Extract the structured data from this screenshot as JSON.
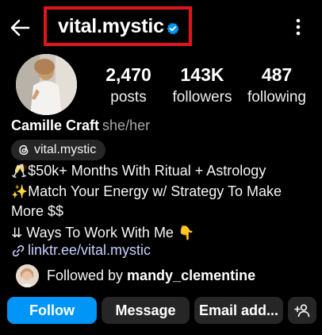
{
  "header": {
    "username": "vital.mystic",
    "accent": "#0095f6",
    "highlight_color": "#e0141e",
    "icons": [
      "back-arrow-icon",
      "verified-badge-icon",
      "more-options-icon"
    ]
  },
  "stats": {
    "posts": {
      "value": "2,470",
      "label": "posts"
    },
    "followers": {
      "value": "143K",
      "label": "followers"
    },
    "following": {
      "value": "487",
      "label": "following"
    }
  },
  "profile": {
    "name": "Camille Craft",
    "pronouns": "she/her",
    "threads_handle": "vital.mystic",
    "bio": [
      {
        "emoji": "🥂",
        "text": "$50k+ Months With Ritual + Astrology"
      },
      {
        "emoji": "✨",
        "text": "Match Your Energy w/ Strategy To Make"
      },
      {
        "emoji": "",
        "text": "More $$"
      },
      {
        "emoji": "⇊",
        "text": " Ways To Work With Me",
        "trail_emoji": "👇"
      }
    ],
    "link": "linktr.ee/vital.mystic"
  },
  "followed_by": {
    "prefix": "Followed by",
    "user": "mandy_clementine"
  },
  "actions": {
    "follow": "Follow",
    "message": "Message",
    "email": "Email add...",
    "add_person_icon": "add-person-icon"
  }
}
